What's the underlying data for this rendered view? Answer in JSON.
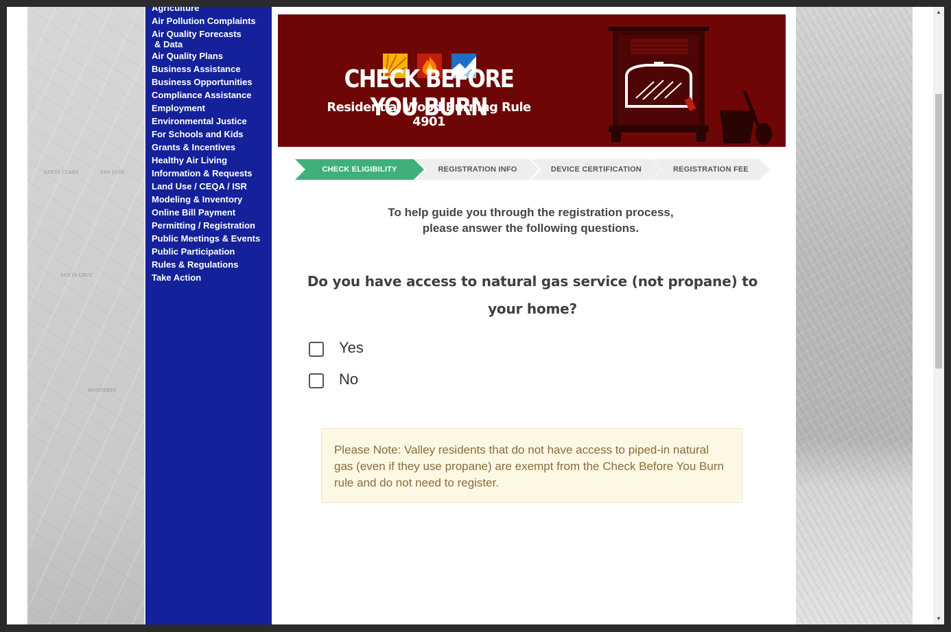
{
  "sidebar": {
    "items": [
      {
        "label": "Agriculture"
      },
      {
        "label": "Air Pollution Complaints"
      },
      {
        "label": "Air Quality Forecasts",
        "line2": "& Data"
      },
      {
        "label": "Air Quality Plans"
      },
      {
        "label": "Business Assistance"
      },
      {
        "label": "Business Opportunities"
      },
      {
        "label": "Compliance Assistance"
      },
      {
        "label": "Employment"
      },
      {
        "label": "Environmental Justice"
      },
      {
        "label": "For Schools and Kids"
      },
      {
        "label": "Grants & Incentives"
      },
      {
        "label": "Healthy Air Living"
      },
      {
        "label": "Information & Requests"
      },
      {
        "label": "Land Use / CEQA / ISR"
      },
      {
        "label": "Modeling & Inventory"
      },
      {
        "label": "Online Bill Payment"
      },
      {
        "label": "Permitting / Registration"
      },
      {
        "label": "Public Meetings & Events"
      },
      {
        "label": "Public Participation"
      },
      {
        "label": "Rules & Regulations"
      },
      {
        "label": "Take Action"
      }
    ]
  },
  "background_map_labels": [
    "SANTA CLARA",
    "SAN JOSE",
    "SANTA CRUZ",
    "MONTEREY"
  ],
  "banner": {
    "title": "CHECK BEFORE YOU BURN",
    "subtitle": "Residential Wood Burning Rule 4901",
    "background": "#6e0606",
    "icons": [
      "sun-icon",
      "flame-icon",
      "mountain-icon"
    ]
  },
  "steps": [
    {
      "label": "CHECK ELIGIBILITY",
      "active": true
    },
    {
      "label": "REGISTRATION INFO",
      "active": false
    },
    {
      "label": "DEVICE CERTIFICATION",
      "active": false
    },
    {
      "label": "REGISTRATION FEE",
      "active": false
    }
  ],
  "step_colors": {
    "active": "#3fb07a",
    "inactive": "#eeeeee"
  },
  "intro": {
    "line1": "To help guide you through the registration process,",
    "line2": "please answer the following questions."
  },
  "question": "Do you have access to natural gas service (not propane) to your home?",
  "options": [
    {
      "label": "Yes",
      "checked": false
    },
    {
      "label": "No",
      "checked": false
    }
  ],
  "note": "Please Note: Valley residents that do not have access to piped-in natural gas (even if they use propane) are exempt from the Check Before You Burn rule and do not need to register.",
  "colors": {
    "sidebar": "#14219a",
    "note_bg": "#fcf8e3",
    "note_text": "#8a6d3b"
  }
}
